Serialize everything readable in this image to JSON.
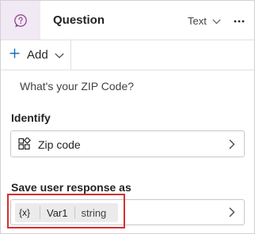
{
  "header": {
    "title": "Question",
    "type_select": "Text",
    "icons": {
      "node": "question-bubble-icon",
      "type_chevron": "chevron-down-icon",
      "more": "more-horizontal-icon"
    },
    "colors": {
      "icon_bg": "#f1e9f3",
      "icon_fg": "#8a3f8f"
    }
  },
  "toolbar": {
    "add_label": "Add",
    "icons": {
      "plus": "plus-icon",
      "chevron": "chevron-down-icon"
    },
    "accent": "#0f6cbd"
  },
  "message": "What's your ZIP Code?",
  "identify": {
    "label": "Identify",
    "value": "Zip code",
    "icon": "entity-icon"
  },
  "save_response": {
    "label": "Save user response as",
    "variable_token": "{x}",
    "variable_name": "Var1",
    "variable_type": "string",
    "highlight_color": "#d32f2f"
  }
}
